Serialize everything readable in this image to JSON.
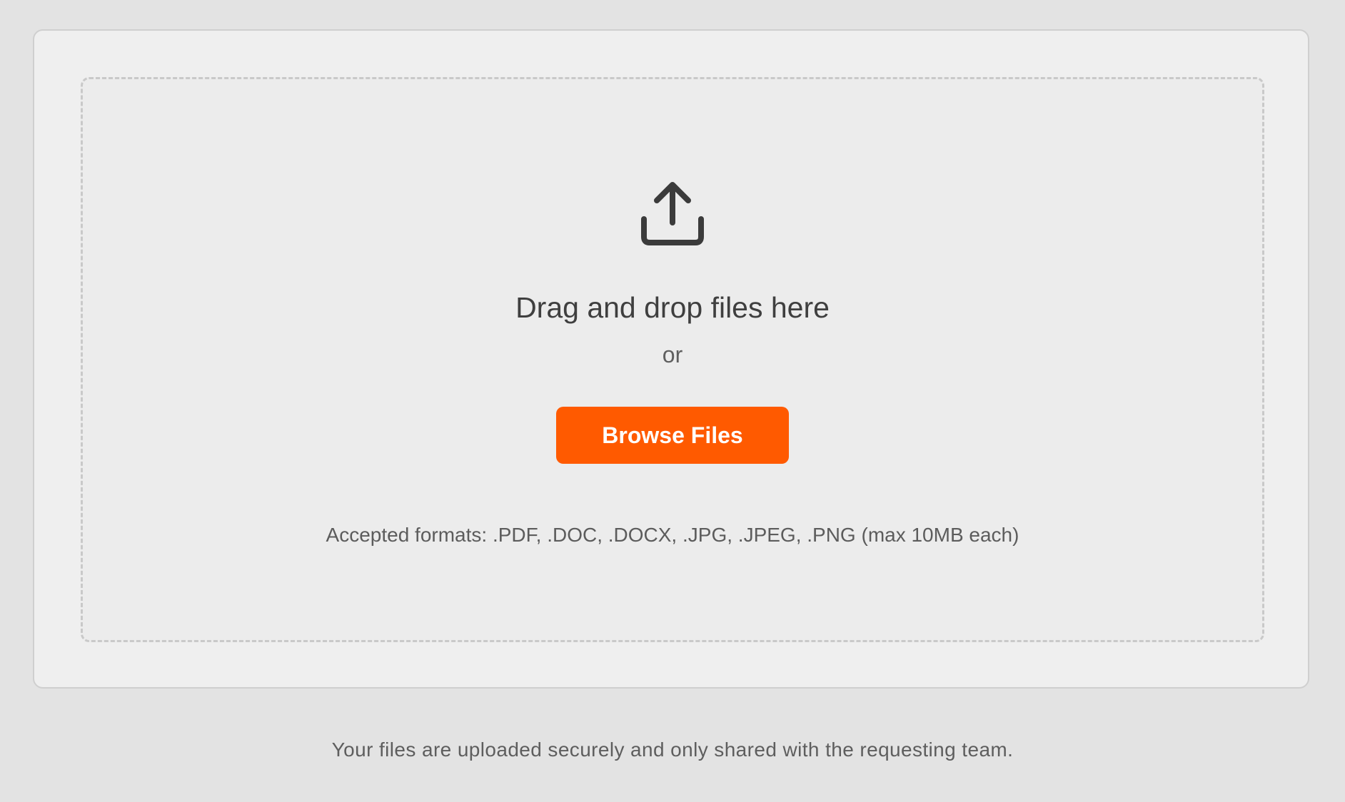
{
  "upload": {
    "icon": "upload-icon",
    "title": "Drag and drop files here",
    "separator": "or",
    "button_label": "Browse Files",
    "formats_text": "Accepted formats: .PDF, .DOC, .DOCX, .JPG, .JPEG, .PNG (max 10MB each)"
  },
  "footer": {
    "note": "Your files are uploaded securely and only shared with the requesting team."
  },
  "colors": {
    "page_background": "#e3e3e3",
    "card_background": "#efefef",
    "button_accent": "#ff5a00",
    "text_primary": "#3f3f3f",
    "text_secondary": "#5f5f5f"
  }
}
